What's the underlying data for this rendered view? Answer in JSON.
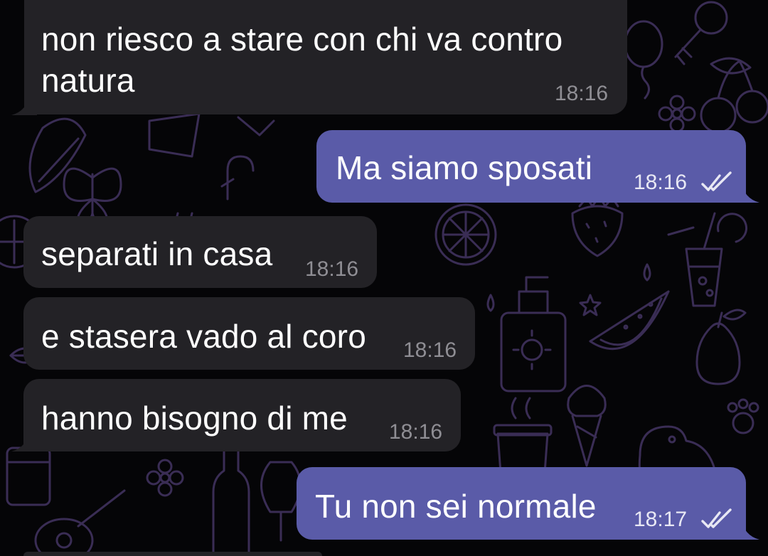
{
  "colors": {
    "background": "#050507",
    "incoming_bubble": "#232226",
    "outgoing_bubble": "#5a5ba8",
    "doodle_stroke": "#3a2d55"
  },
  "messages": [
    {
      "direction": "incoming",
      "text_lines": [
        "non riesco a stare con chi va contro",
        "natura"
      ],
      "time": "18:16"
    },
    {
      "direction": "outgoing",
      "text": "Ma siamo sposati",
      "time": "18:16",
      "status_icon": "double-check-icon"
    },
    {
      "direction": "incoming",
      "text": "separati in casa",
      "time": "18:16"
    },
    {
      "direction": "incoming",
      "text": "e stasera vado al coro",
      "time": "18:16"
    },
    {
      "direction": "incoming",
      "text": "hanno bisogno di me",
      "time": "18:16"
    },
    {
      "direction": "outgoing",
      "text": "Tu non sei normale",
      "time": "18:17",
      "status_icon": "double-check-icon"
    }
  ]
}
